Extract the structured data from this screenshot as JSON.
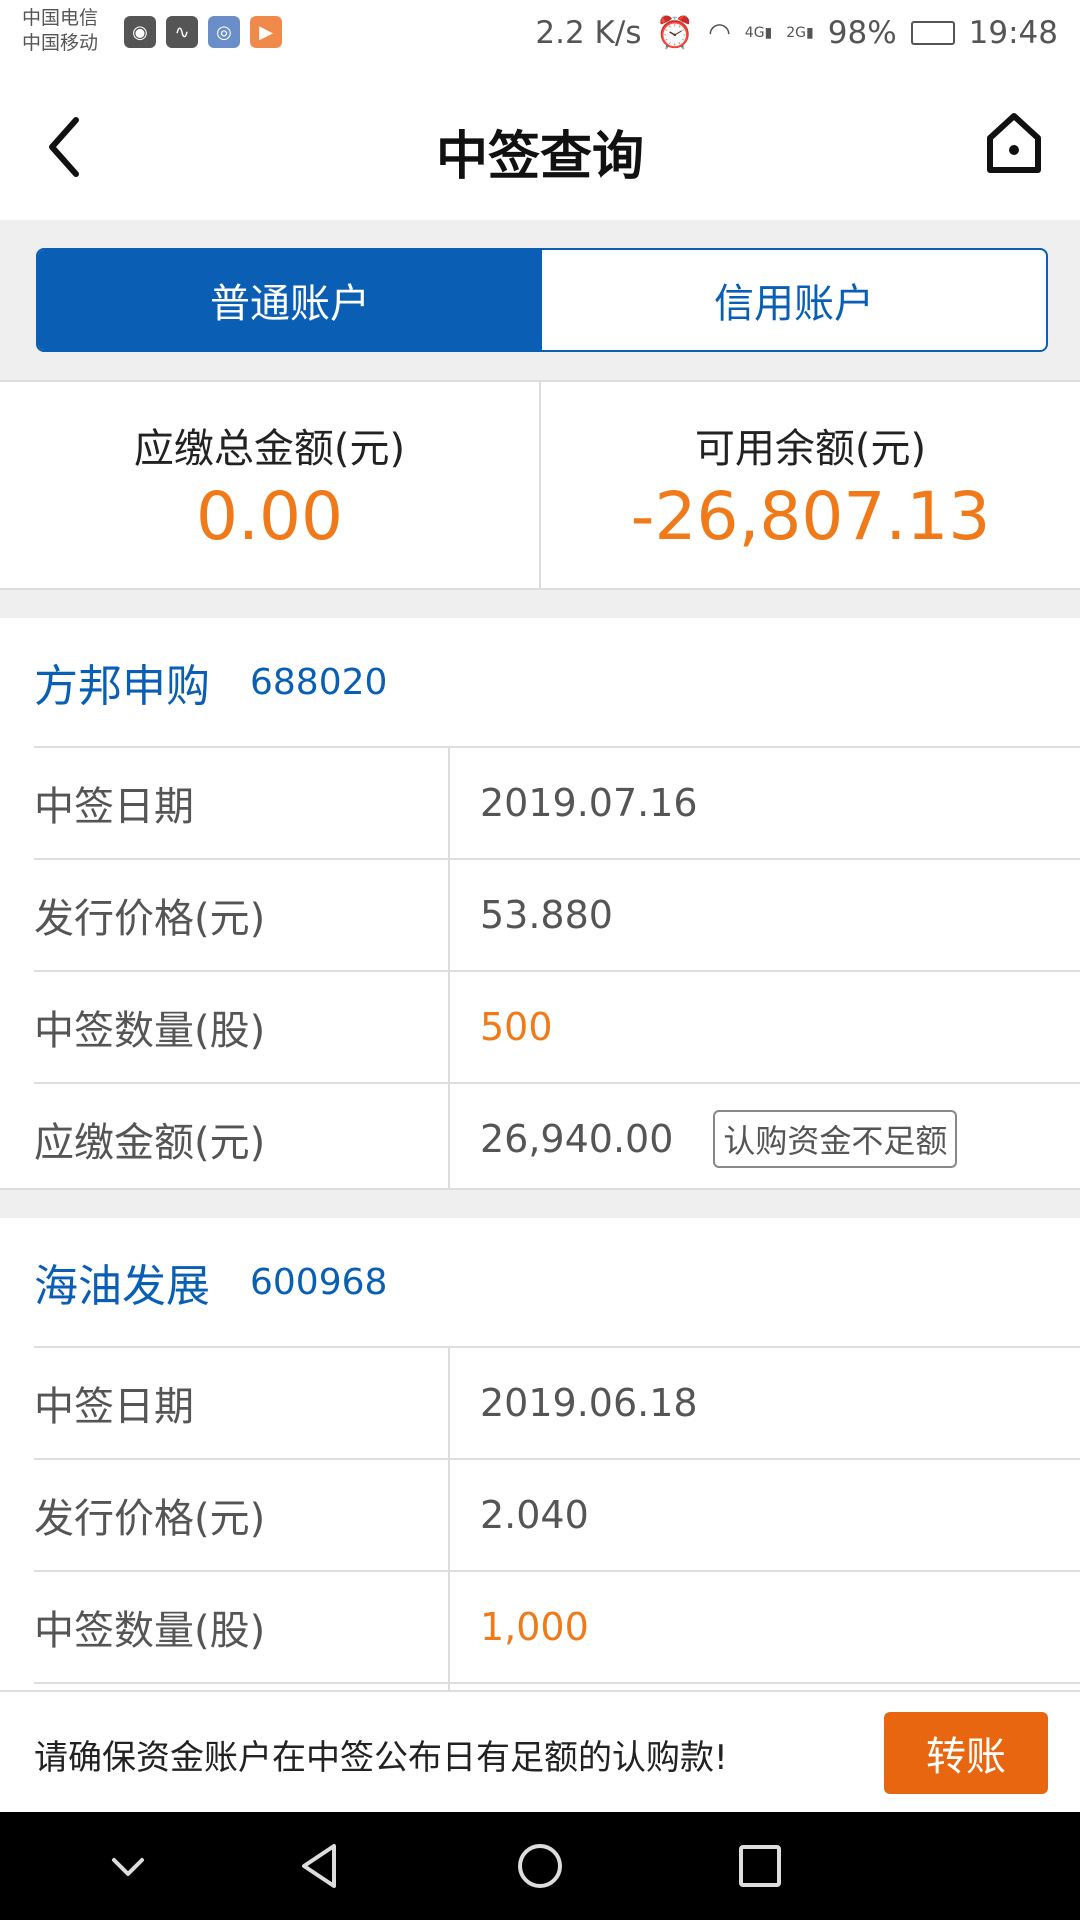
{
  "status_bar": {
    "carrier1": "中国电信",
    "carrier2": "中国移动",
    "speed": "2.2 K/s",
    "network1": "4G",
    "network2": "2G",
    "battery": "98%",
    "time": "19:48"
  },
  "header": {
    "title": "中签查询"
  },
  "tabs": [
    {
      "label": "普通账户",
      "active": true
    },
    {
      "label": "信用账户",
      "active": false
    }
  ],
  "summary": {
    "total_due_label": "应缴总金额(元)",
    "total_due_value": "0.00",
    "available_label": "可用余额(元)",
    "available_value": "-26,807.13"
  },
  "stocks": [
    {
      "name": "方邦申购",
      "code": "688020",
      "date_label": "中签日期",
      "date": "2019.07.16",
      "price_label": "发行价格(元)",
      "price": "53.880",
      "qty_label": "中签数量(股)",
      "qty": "500",
      "due_label": "应缴金额(元)",
      "due": "26,940.00",
      "warning": "认购资金不足额"
    },
    {
      "name": "海油发展",
      "code": "600968",
      "date_label": "中签日期",
      "date": "2019.06.18",
      "price_label": "发行价格(元)",
      "price": "2.040",
      "qty_label": "中签数量(股)",
      "qty": "1,000"
    }
  ],
  "footer": {
    "notice": "请确保资金账户在中签公布日有足额的认购款!",
    "transfer_label": "转账"
  },
  "colors": {
    "primary_blue": "#0a5fb4",
    "orange": "#f07a1a",
    "button_orange": "#e8660f"
  }
}
